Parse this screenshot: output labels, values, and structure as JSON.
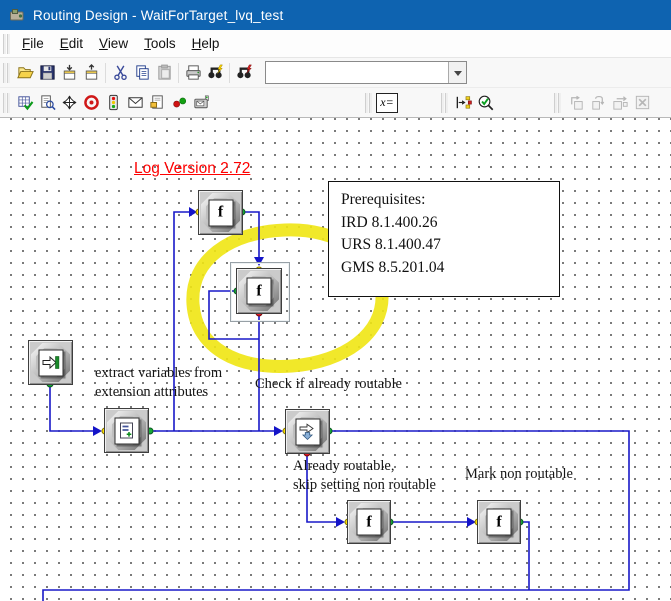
{
  "window": {
    "title": "Routing Design - WaitForTarget_lvq_test"
  },
  "menu": {
    "items": [
      {
        "label": "File"
      },
      {
        "label": "Edit"
      },
      {
        "label": "View"
      },
      {
        "label": "Tools"
      },
      {
        "label": "Help"
      }
    ]
  },
  "toolbar_main": {
    "search_value": "",
    "icons": [
      "open",
      "save",
      "check-in",
      "check-out",
      "cut",
      "copy",
      "paste",
      "print",
      "find",
      "find-with-filter"
    ]
  },
  "toolbar_tools": {
    "variables_label": "x=",
    "icons": [
      "validate-grid",
      "preview-page",
      "navigate-diamond",
      "breakpoint-target",
      "traffic-light",
      "send-message",
      "page-note",
      "connection-dots",
      "device-mail",
      "variables",
      "flow-check",
      "zoom-verify",
      "disabled-box-arrow-1",
      "disabled-box-arrow-2",
      "disabled-box-arrow-3",
      "disabled-delete"
    ]
  },
  "canvas": {
    "version_label": "Log Version 2.72",
    "prerequisites_box": {
      "lines": [
        "Prerequisites:",
        "IRD 8.1.400.26",
        "URS 8.1.400.47",
        "GMS 8.5.201.04"
      ]
    },
    "function_glyph": "f",
    "annotations": [
      {
        "id": "extract",
        "line1": "extract variables from",
        "line2": "extension attributes"
      },
      {
        "id": "check",
        "line1": "Check if already routable"
      },
      {
        "id": "already",
        "line1": "Already routable,",
        "line2": "skip setting non routable"
      },
      {
        "id": "mark",
        "line1": "Mark non routable"
      }
    ],
    "colors": {
      "connector": "#1818c8",
      "highlight": "#f0e613",
      "port_in": "#ffe400",
      "port_out": "#18a838",
      "port_error": "#e01828"
    }
  }
}
